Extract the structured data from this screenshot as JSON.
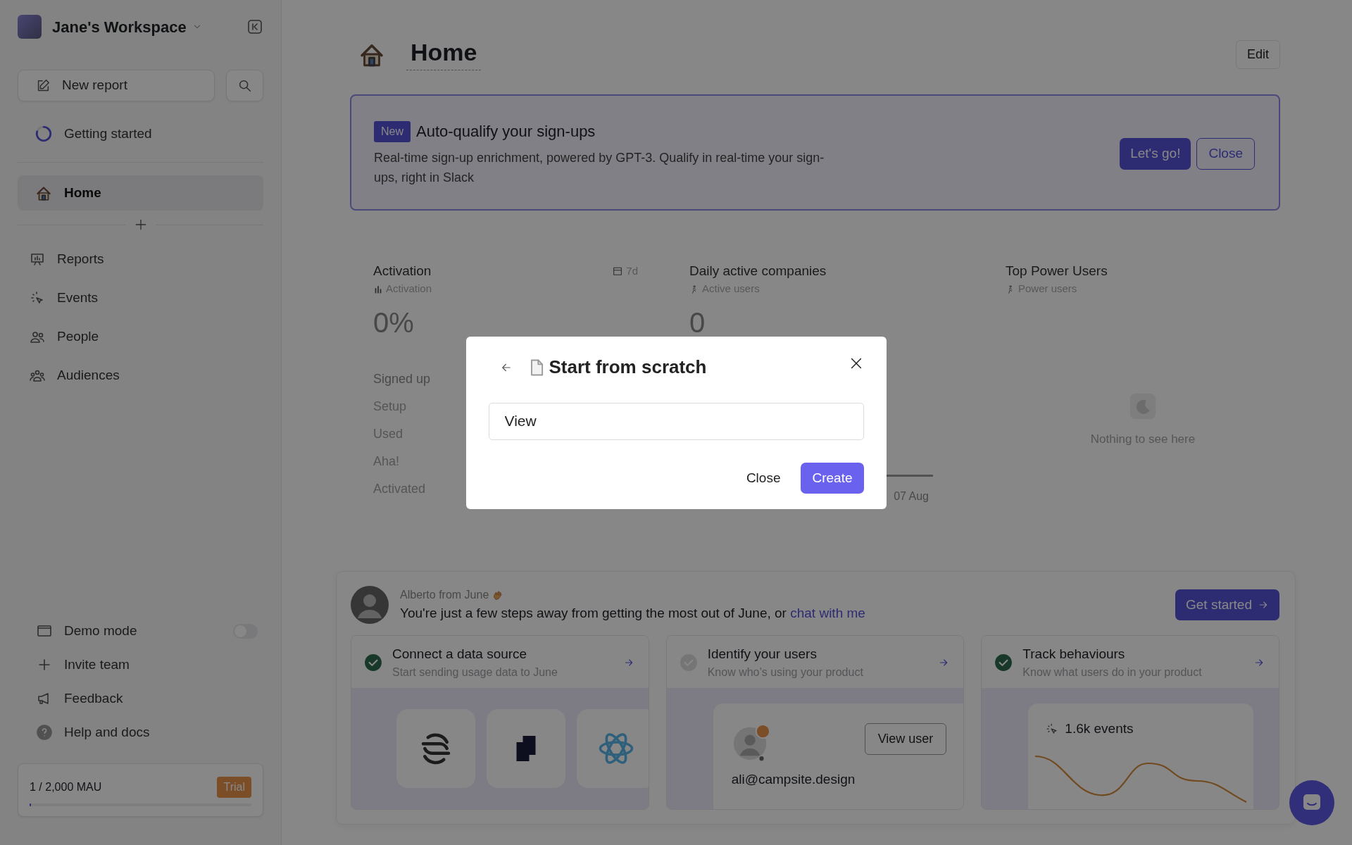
{
  "sidebar": {
    "workspace": "Jane's Workspace",
    "new_report": "New report",
    "getting_started": "Getting started",
    "pinned": [
      {
        "label": "Home",
        "selected": true
      }
    ],
    "nav": [
      {
        "label": "Reports",
        "kind": "reports"
      },
      {
        "label": "Events",
        "kind": "events"
      },
      {
        "label": "People",
        "kind": "people"
      },
      {
        "label": "Audiences",
        "kind": "audiences"
      }
    ],
    "footer_items": [
      {
        "label": "Demo mode",
        "kind": "toggle",
        "on": false
      },
      {
        "label": "Invite team",
        "kind": "invite"
      },
      {
        "label": "Feedback",
        "kind": "feedback"
      },
      {
        "label": "Help and docs",
        "kind": "help"
      }
    ],
    "usage": {
      "text": "1 / 2,000 MAU",
      "badge": "Trial",
      "level": 0.0005
    }
  },
  "header": {
    "title": "Home",
    "edit": "Edit"
  },
  "banner": {
    "badge": "New",
    "title": "Auto-qualify your sign-ups",
    "text": "Real-time sign-up enrichment, powered by GPT-3. Qualify in real-time your sign-ups, right in Slack",
    "primary": "Let's go!",
    "secondary": "Close"
  },
  "metrics": [
    {
      "kind": "funnel",
      "title": "Activation",
      "subtitle": "Activation",
      "period": "7d",
      "value": "0%",
      "steps": [
        "Signed up",
        "Setup",
        "Used",
        "Aha!",
        "Activated"
      ]
    },
    {
      "kind": "line",
      "title": "Daily active companies",
      "subtitle": "Active users",
      "value": "0",
      "axis_label": "07 Aug"
    },
    {
      "kind": "empty",
      "title": "Top Power Users",
      "subtitle": "Power users",
      "empty": "Nothing to see here"
    }
  ],
  "onboarding": {
    "author": "Alberto from June",
    "message": "You're just a few steps away from getting the most out of June, or ",
    "link": "chat with me",
    "button": "Get started",
    "steps": [
      {
        "kind": "integrations",
        "title": "Connect a data source",
        "subtitle": "Start sending usage data to June",
        "done": true
      },
      {
        "kind": "user",
        "title": "Identify your users",
        "subtitle": "Know who’s using your product",
        "done": false,
        "button": "View user",
        "email": "ali@campsite.design"
      },
      {
        "kind": "events",
        "title": "Track behaviours",
        "subtitle": "Know what users do in your product",
        "done": true,
        "events": "1.6k events"
      }
    ]
  },
  "modal": {
    "title": "Start from scratch",
    "value": "View",
    "close": "Close",
    "create": "Create"
  }
}
